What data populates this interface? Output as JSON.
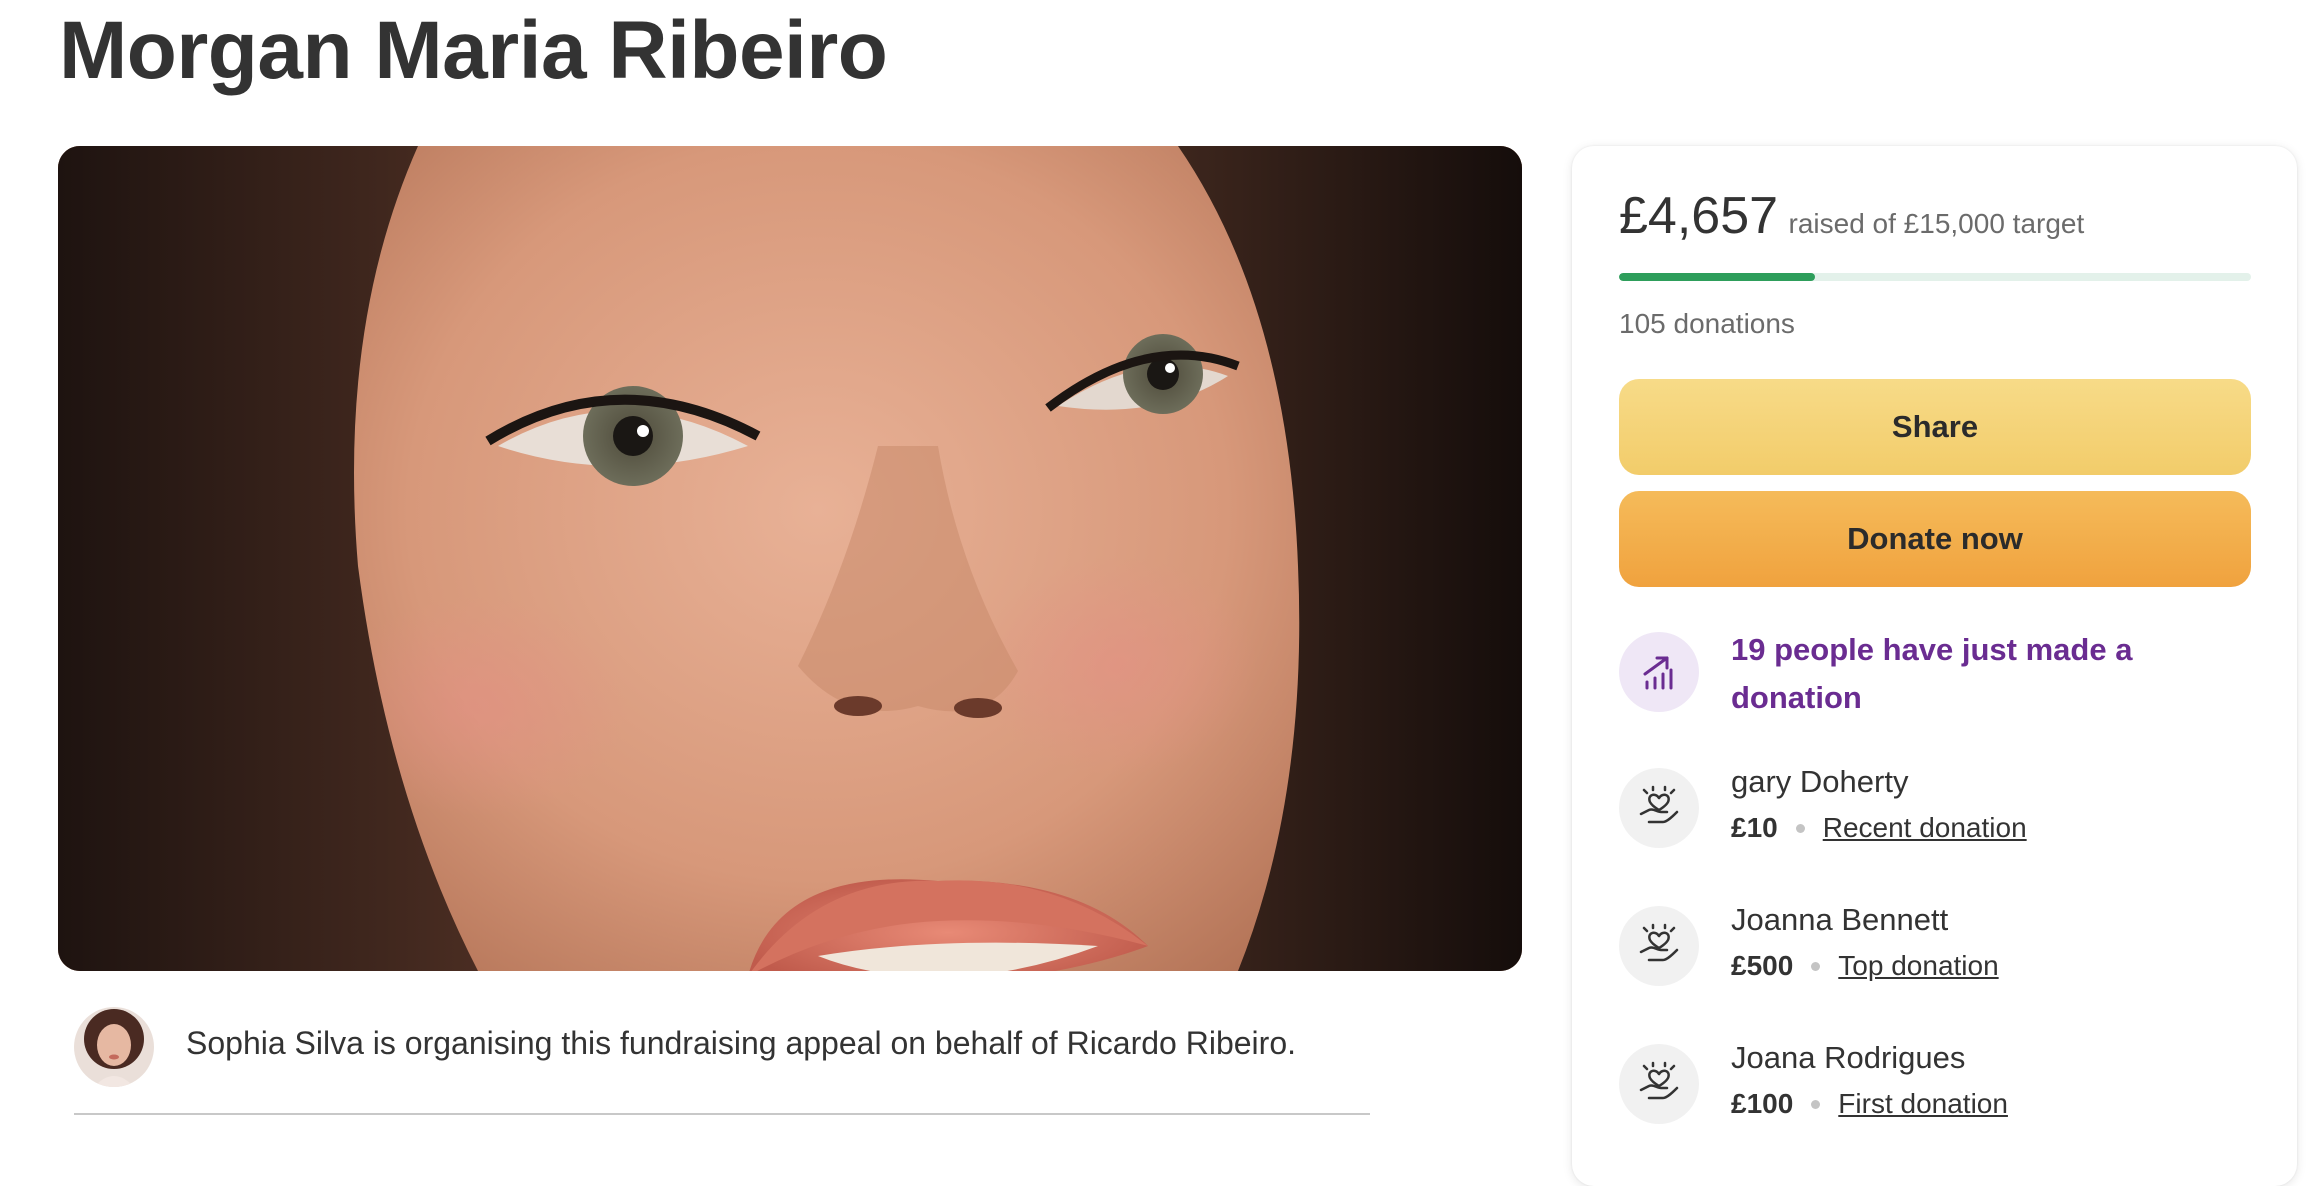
{
  "page": {
    "title": "Morgan Maria Ribeiro"
  },
  "organiser": {
    "text": "Sophia Silva is organising this fundraising appeal on behalf of Ricardo Ribeiro."
  },
  "fundraiser": {
    "raised": "£4,657",
    "raised_suffix": "raised of £15,000 target",
    "progress_fraction": 0.31,
    "donations_count": "105 donations",
    "share_label": "Share",
    "donate_label": "Donate now",
    "recent_activity": "19 people have just made a donation",
    "donors": [
      {
        "name": "gary Doherty",
        "amount": "£10",
        "tag": "Recent donation"
      },
      {
        "name": "Joanna Bennett",
        "amount": "£500",
        "tag": "Top donation"
      },
      {
        "name": "Joana Rodrigues",
        "amount": "£100",
        "tag": "First donation"
      }
    ]
  },
  "icons": {
    "trend": "trending-up-chart-icon",
    "donor": "hand-heart-icon"
  },
  "colors": {
    "progress": "#2e9e5b",
    "progress_track": "#e3f1ea",
    "share_button": "#f2cc6a",
    "donate_button": "#f0a23e",
    "activity_text": "#6a2c91"
  }
}
